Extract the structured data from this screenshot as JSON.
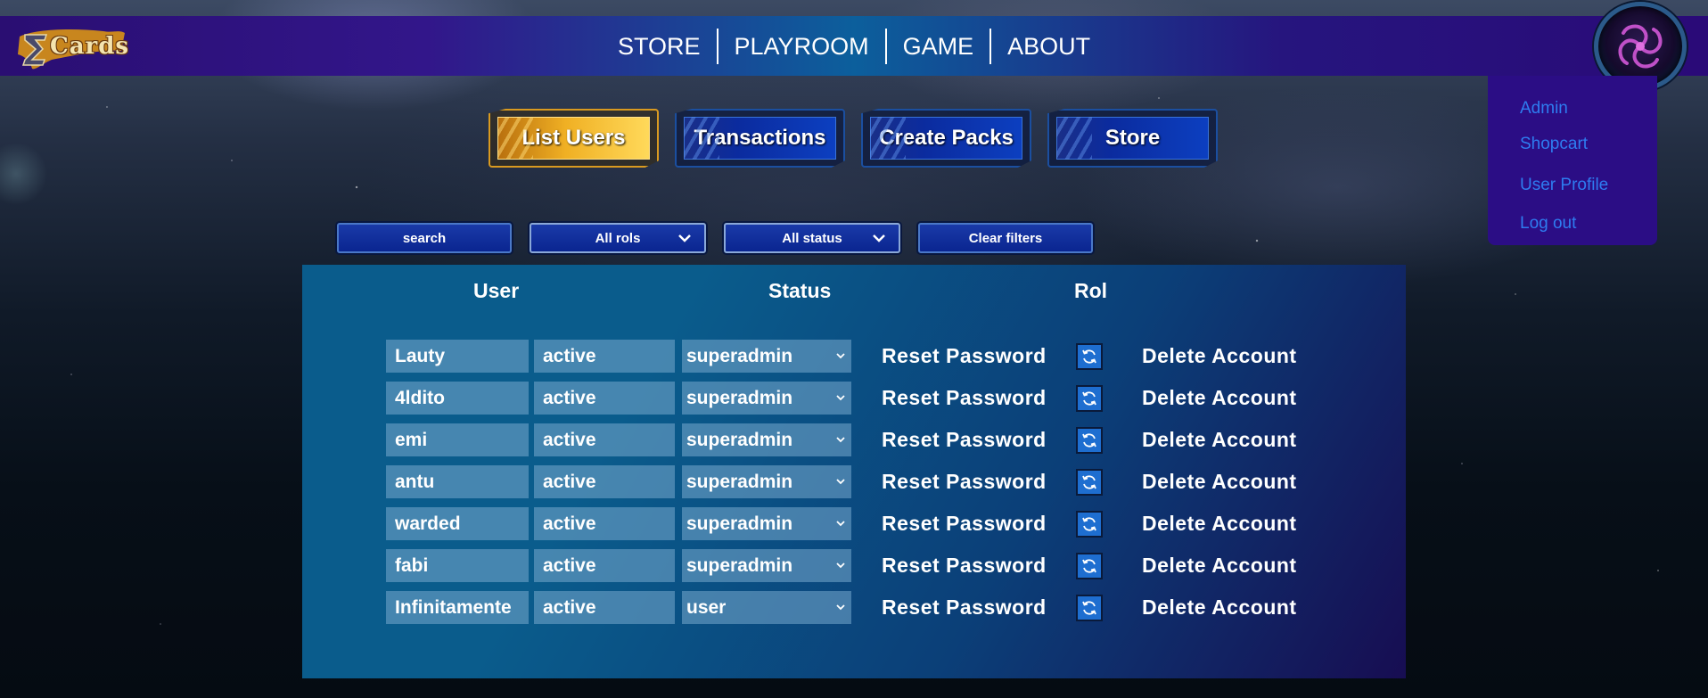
{
  "brand": {
    "logo_text": "Cards"
  },
  "nav": {
    "items": [
      "STORE",
      "PLAYROOM",
      "GAME",
      "ABOUT"
    ]
  },
  "user_menu": {
    "items": [
      "Admin",
      "Shopcart",
      "User Profile",
      "Log out"
    ]
  },
  "tabs": [
    {
      "label": "List Users",
      "active": true
    },
    {
      "label": "Transactions",
      "active": false
    },
    {
      "label": "Create Packs",
      "active": false
    },
    {
      "label": "Store",
      "active": false
    }
  ],
  "filters": {
    "search_label": "search",
    "rol_selected": "All rols",
    "status_selected": "All status",
    "clear_label": "Clear filters"
  },
  "table": {
    "headers": {
      "user": "User",
      "status": "Status",
      "rol": "Rol"
    },
    "rows": [
      {
        "user": "Lauty",
        "status": "active",
        "rol": "superadmin",
        "reset": "Reset Password",
        "delete": "Delete Account"
      },
      {
        "user": "4ldito",
        "status": "active",
        "rol": "superadmin",
        "reset": "Reset Password",
        "delete": "Delete Account"
      },
      {
        "user": "emi",
        "status": "active",
        "rol": "superadmin",
        "reset": "Reset Password",
        "delete": "Delete Account"
      },
      {
        "user": "antu",
        "status": "active",
        "rol": "superadmin",
        "reset": "Reset Password",
        "delete": "Delete Account"
      },
      {
        "user": "warded",
        "status": "active",
        "rol": "superadmin",
        "reset": "Reset Password",
        "delete": "Delete Account"
      },
      {
        "user": "fabi",
        "status": "active",
        "rol": "superadmin",
        "reset": "Reset Password",
        "delete": "Delete Account"
      },
      {
        "user": "Infinitamente",
        "status": "active",
        "rol": "user",
        "reset": "Reset Password",
        "delete": "Delete Account"
      }
    ]
  },
  "colors": {
    "navbar_start": "#2a0e72",
    "navbar_mid": "#0c5f9c",
    "dropdown_bg": "#2b0d85",
    "dropdown_link": "#2e7cf0",
    "active_tab": "#f0b024",
    "panel": "#0a5c8c"
  },
  "icons": {
    "logo": "sigma-logo-icon",
    "avatar": "zerg-emblem-icon",
    "refresh": "refresh-icon",
    "chevron": "chevron-down-icon"
  }
}
